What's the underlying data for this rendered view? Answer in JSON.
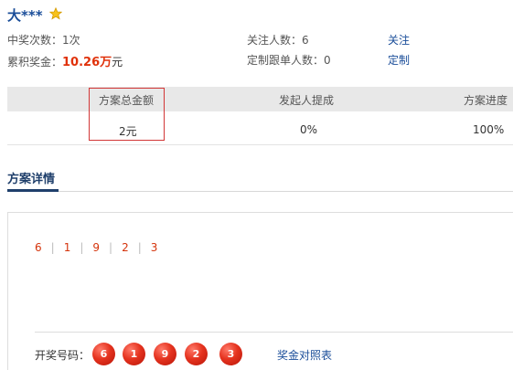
{
  "user": {
    "name": "大***"
  },
  "stats": {
    "wins_label": "中奖次数：",
    "wins_value": "1次",
    "prize_label": "累积奖金：",
    "prize_amount": "10.26万",
    "prize_unit": "元",
    "followers_label": "关注人数：",
    "followers_value": "6",
    "custom_label": "定制跟单人数：",
    "custom_value": "0",
    "follow_link": "关注",
    "custom_link": "定制"
  },
  "plan_table": {
    "headers": [
      "方案总金额",
      "发起人提成",
      "方案进度"
    ],
    "values": [
      "2元",
      "0%",
      "100%"
    ]
  },
  "section": {
    "title": "方案详情"
  },
  "picks": [
    "6",
    "1",
    "9",
    "2",
    "3"
  ],
  "draw": {
    "label": "开奖号码：",
    "numbers": [
      "6",
      "1",
      "9",
      "2",
      "3"
    ],
    "prize_table_link": "奖金对照表"
  },
  "colors": {
    "accent_red": "#e0310a",
    "link_blue": "#1a4d99",
    "ball_red": "#e5331f"
  },
  "icons": {
    "vip": "star-icon"
  }
}
